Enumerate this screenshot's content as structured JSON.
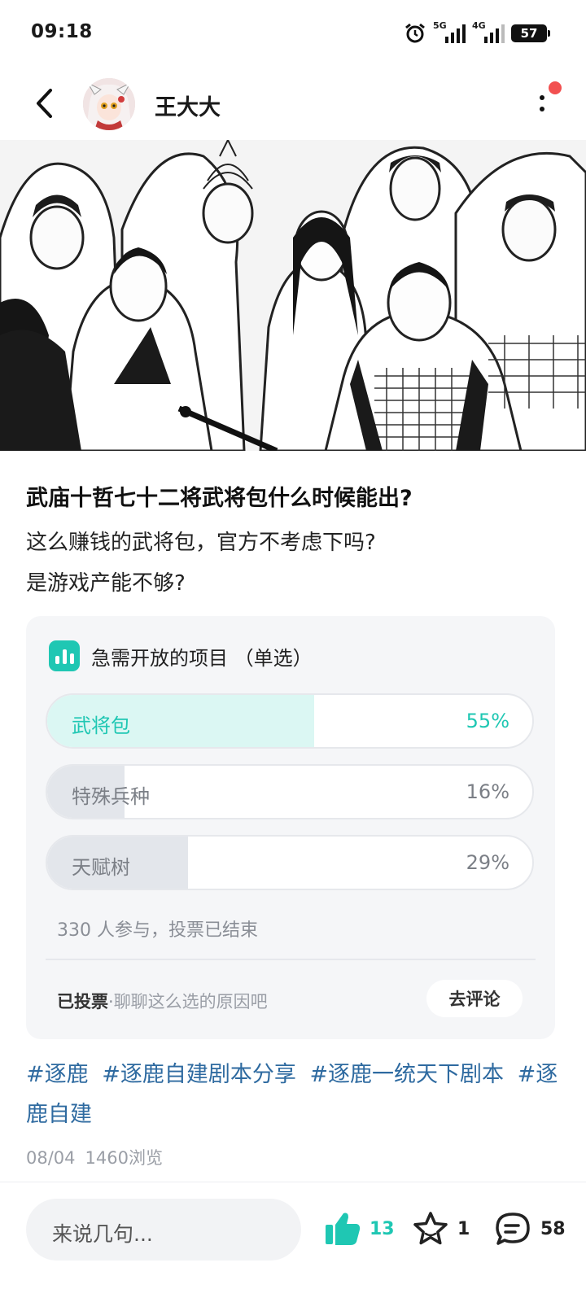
{
  "status_bar": {
    "time": "09:18",
    "network_1": "5G",
    "network_2": "4G",
    "battery": "57",
    "icons": [
      "alarm-icon",
      "signal-5g-icon",
      "signal-4g-icon",
      "battery-icon"
    ]
  },
  "header": {
    "username": "王大大",
    "icons": [
      "back-arrow-icon",
      "more-icon"
    ],
    "notification_dot_color": "#f25050"
  },
  "post": {
    "title": "武庙十哲七十二将武将包什么时候能出?",
    "body_lines": [
      "这么赚钱的武将包，官方不考虑下吗?",
      "是游戏产能不够?"
    ]
  },
  "poll": {
    "title": "急需开放的项目 （单选）",
    "options": [
      {
        "label": "武将包",
        "percent": "55%",
        "value": 0.55,
        "selected": true
      },
      {
        "label": "特殊兵种",
        "percent": "16%",
        "value": 0.16,
        "selected": false
      },
      {
        "label": "天赋树",
        "percent": "29%",
        "value": 0.29,
        "selected": false
      }
    ],
    "stats": "330 人参与，投票已结束",
    "voted_label": "已投票",
    "voted_sep": "·",
    "voted_hint": "聊聊这么选的原因吧",
    "comment_button": "去评论",
    "accent_color": "#1fc7b3"
  },
  "tags": [
    "#逐鹿",
    "#逐鹿自建剧本分享",
    "#逐鹿一统天下剧本",
    "#逐鹿自建"
  ],
  "meta": {
    "date": "08/04",
    "views": "1460浏览"
  },
  "bottom_bar": {
    "input_placeholder": "来说几句...",
    "likes": "13",
    "favorites": "1",
    "comments": "58",
    "icons": [
      "thumbs-up-icon",
      "star-icon",
      "comment-icon"
    ]
  }
}
